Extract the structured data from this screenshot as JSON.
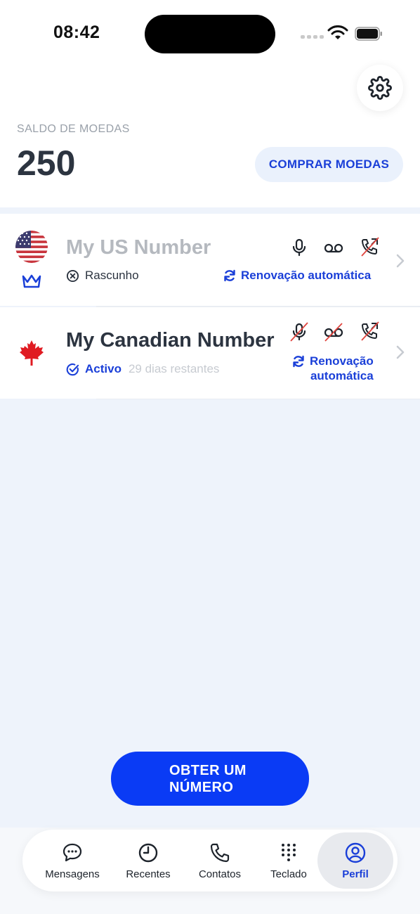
{
  "status_bar": {
    "time": "08:42"
  },
  "header": {
    "balance_label": "SALDO DE MOEDAS",
    "balance_value": "250",
    "buy_button": "COMPRAR MOEDAS",
    "settings_icon": "gear-icon"
  },
  "numbers": [
    {
      "name": "My US Number",
      "flag": "us-flag",
      "status": "Rascunho",
      "status_icon": "x-circle-icon",
      "days_left": "",
      "renewal": "Renovação automática",
      "badge_icon": "crown-icon"
    },
    {
      "name": "My Canadian Number",
      "flag": "canada-flag",
      "status": "Activo",
      "status_icon": "check-circle-icon",
      "days_left": "29 dias restantes",
      "renewal_line1": "Renovação",
      "renewal_line2": "automática"
    }
  ],
  "get_number_button": {
    "line1": "OBTER UM",
    "line2": "NÚMERO"
  },
  "tabs": [
    {
      "label": "Mensagens",
      "icon": "chat-bubble-icon"
    },
    {
      "label": "Recentes",
      "icon": "clock-icon"
    },
    {
      "label": "Contatos",
      "icon": "phone-icon"
    },
    {
      "label": "Teclado",
      "icon": "keypad-icon"
    },
    {
      "label": "Perfil",
      "icon": "profile-icon",
      "active": true
    }
  ],
  "colors": {
    "accent": "#1a3fd8",
    "button": "#0a3bf5",
    "list_bg": "#eef3fb",
    "disabled_strike": "#e0443e"
  }
}
